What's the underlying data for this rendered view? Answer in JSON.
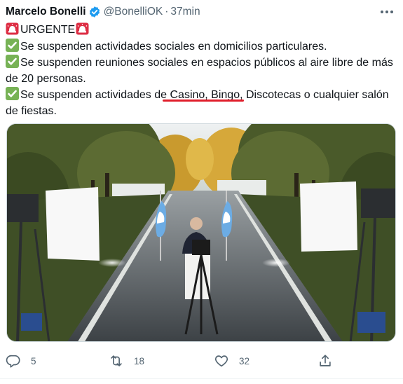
{
  "tweet": {
    "author_name": "Marcelo Bonelli",
    "handle": "@BonelliOK",
    "separator": "·",
    "time": "37min",
    "lines": {
      "urgent": "URGENTE",
      "item1": "Se suspenden actividades sociales en domicilios particulares.",
      "item2a": "Se suspenden reuniones sociales en espacios públicos al aire libre de más",
      "item2b": "de 20 personas.",
      "item3a": "Se suspenden actividades de Casino, Bingo, Discotecas o cualquier salón",
      "item3b": "de fiestas."
    },
    "actions": {
      "reply_count": "5",
      "retweet_count": "18",
      "like_count": "32"
    }
  },
  "icons": {
    "verified": "verified-badge-icon",
    "more": "more-options-icon",
    "alarm": "police-light-emoji",
    "check": "check-mark-emoji",
    "reply": "reply-icon",
    "retweet": "retweet-icon",
    "like": "heart-icon",
    "share": "share-icon"
  },
  "colors": {
    "verified_blue": "#1d9bf0",
    "secondary_text": "#536471",
    "check_green": "#77b255",
    "alarm_red": "#dd2e44",
    "annotation_red": "#e01e2b"
  }
}
